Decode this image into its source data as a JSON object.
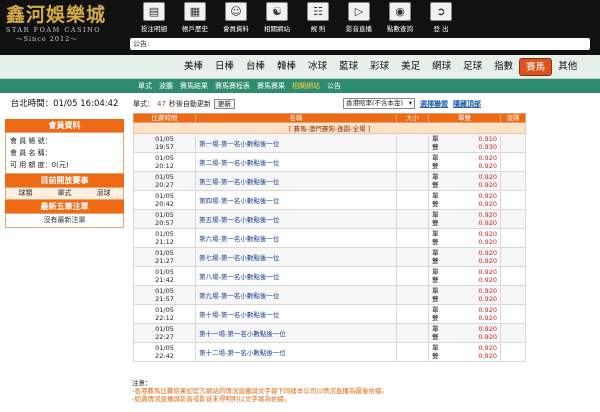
{
  "brand": {
    "title": "鑫河娛樂城",
    "subtitle": "STAR FOAM CASINO",
    "since": "～Since 2012～"
  },
  "top_icons": [
    {
      "label": "投注明細",
      "icon": "receipt-icon"
    },
    {
      "label": "帳戶歷史",
      "icon": "history-icon"
    },
    {
      "label": "會員資料",
      "icon": "user-icon"
    },
    {
      "label": "相關網站",
      "icon": "globe-icon"
    },
    {
      "label": "規 則",
      "icon": "rules-icon"
    },
    {
      "label": "影音直播",
      "icon": "video-icon"
    },
    {
      "label": "點數查詢",
      "icon": "coins-icon"
    },
    {
      "label": "登 出",
      "icon": "logout-icon"
    }
  ],
  "announcement": {
    "label": "公告:"
  },
  "sport_tabs": [
    "美棒",
    "日棒",
    "台棒",
    "韓棒",
    "冰球",
    "藍球",
    "彩球",
    "美足",
    "網球",
    "足球",
    "指數",
    "賽馬",
    "其他"
  ],
  "active_sport": "賽馬",
  "sub_tabs": [
    "單式",
    "波膽",
    "賽馬結果",
    "賽馬賽程表",
    "賽馬賽果",
    "相關網站",
    "公告"
  ],
  "active_sub": "相關網站",
  "clock": "台北時間：01/05 16:04:42",
  "member": {
    "title": "會員資料",
    "account_label": "會 員 帳 號：",
    "name_label": "會 員 名 稱：",
    "credit_label": "可 用 額 度：0(元)"
  },
  "open_events": {
    "title": "目前開放賽事",
    "modes": [
      "球類",
      "單式",
      "滾球"
    ]
  },
  "recent_bets": {
    "title": "最新五筆注單",
    "empty": "沒有最新注單"
  },
  "toolbar": {
    "prefix": "單式：",
    "count": "47",
    "suffix": "秒後自動更新",
    "refresh": "更新",
    "odds_option": "香港賠率(不含本金)",
    "link1": "選擇聯盟",
    "link2": "隱藏頂部"
  },
  "table": {
    "headers": [
      "比賽時間",
      "名稱",
      "大小",
      "單雙",
      "滾隊"
    ],
    "group": "[ 賽馬-澳門賽狗-逸園-全場 ]",
    "pick_labels": [
      "單",
      "雙"
    ],
    "rows": [
      {
        "date": "01/05",
        "time": "19:57",
        "name": "第一場-第一名小數點後一位",
        "odd": "0.910",
        "even": "0.930"
      },
      {
        "date": "01/05",
        "time": "20:12",
        "name": "第二場-第一名小數點後一位",
        "odd": "0.920",
        "even": "0.920"
      },
      {
        "date": "01/05",
        "time": "20:27",
        "name": "第三場-第一名小數點後一位",
        "odd": "0.920",
        "even": "0.920"
      },
      {
        "date": "01/05",
        "time": "20:42",
        "name": "第四場-第一名小數點後一位",
        "odd": "0.920",
        "even": "0.920"
      },
      {
        "date": "01/05",
        "time": "20:57",
        "name": "第五場-第一名小數點後一位",
        "odd": "0.920",
        "even": "0.920"
      },
      {
        "date": "01/05",
        "time": "21:12",
        "name": "第六場-第一名小數點後一位",
        "odd": "0.920",
        "even": "0.920"
      },
      {
        "date": "01/05",
        "time": "21:27",
        "name": "第七場-第一名小數點後一位",
        "odd": "0.920",
        "even": "0.920"
      },
      {
        "date": "01/05",
        "time": "21:42",
        "name": "第八場-第一名小數點後一位",
        "odd": "0.920",
        "even": "0.920"
      },
      {
        "date": "01/05",
        "time": "21:57",
        "name": "第九場-第一名小數點後一位",
        "odd": "0.920",
        "even": "0.920"
      },
      {
        "date": "01/05",
        "time": "22:12",
        "name": "第十場-第一名小數點後一位",
        "odd": "0.920",
        "even": "0.920"
      },
      {
        "date": "01/05",
        "time": "22:27",
        "name": "第十一場-第一名小數點後一位",
        "odd": "0.920",
        "even": "0.920"
      },
      {
        "date": "01/05",
        "time": "22:42",
        "name": "第十二場-第一名小數點後一位",
        "odd": "0.920",
        "even": "0.920"
      }
    ]
  },
  "notes": {
    "title": "注意：",
    "lines": [
      "-香港賽馬比賽結果如官方網站的情況直播與文字報下同樣本公司以情況直播為最後依據。",
      "-如遇情況直播與影音或影音未得明則以文字報為依據。"
    ]
  }
}
